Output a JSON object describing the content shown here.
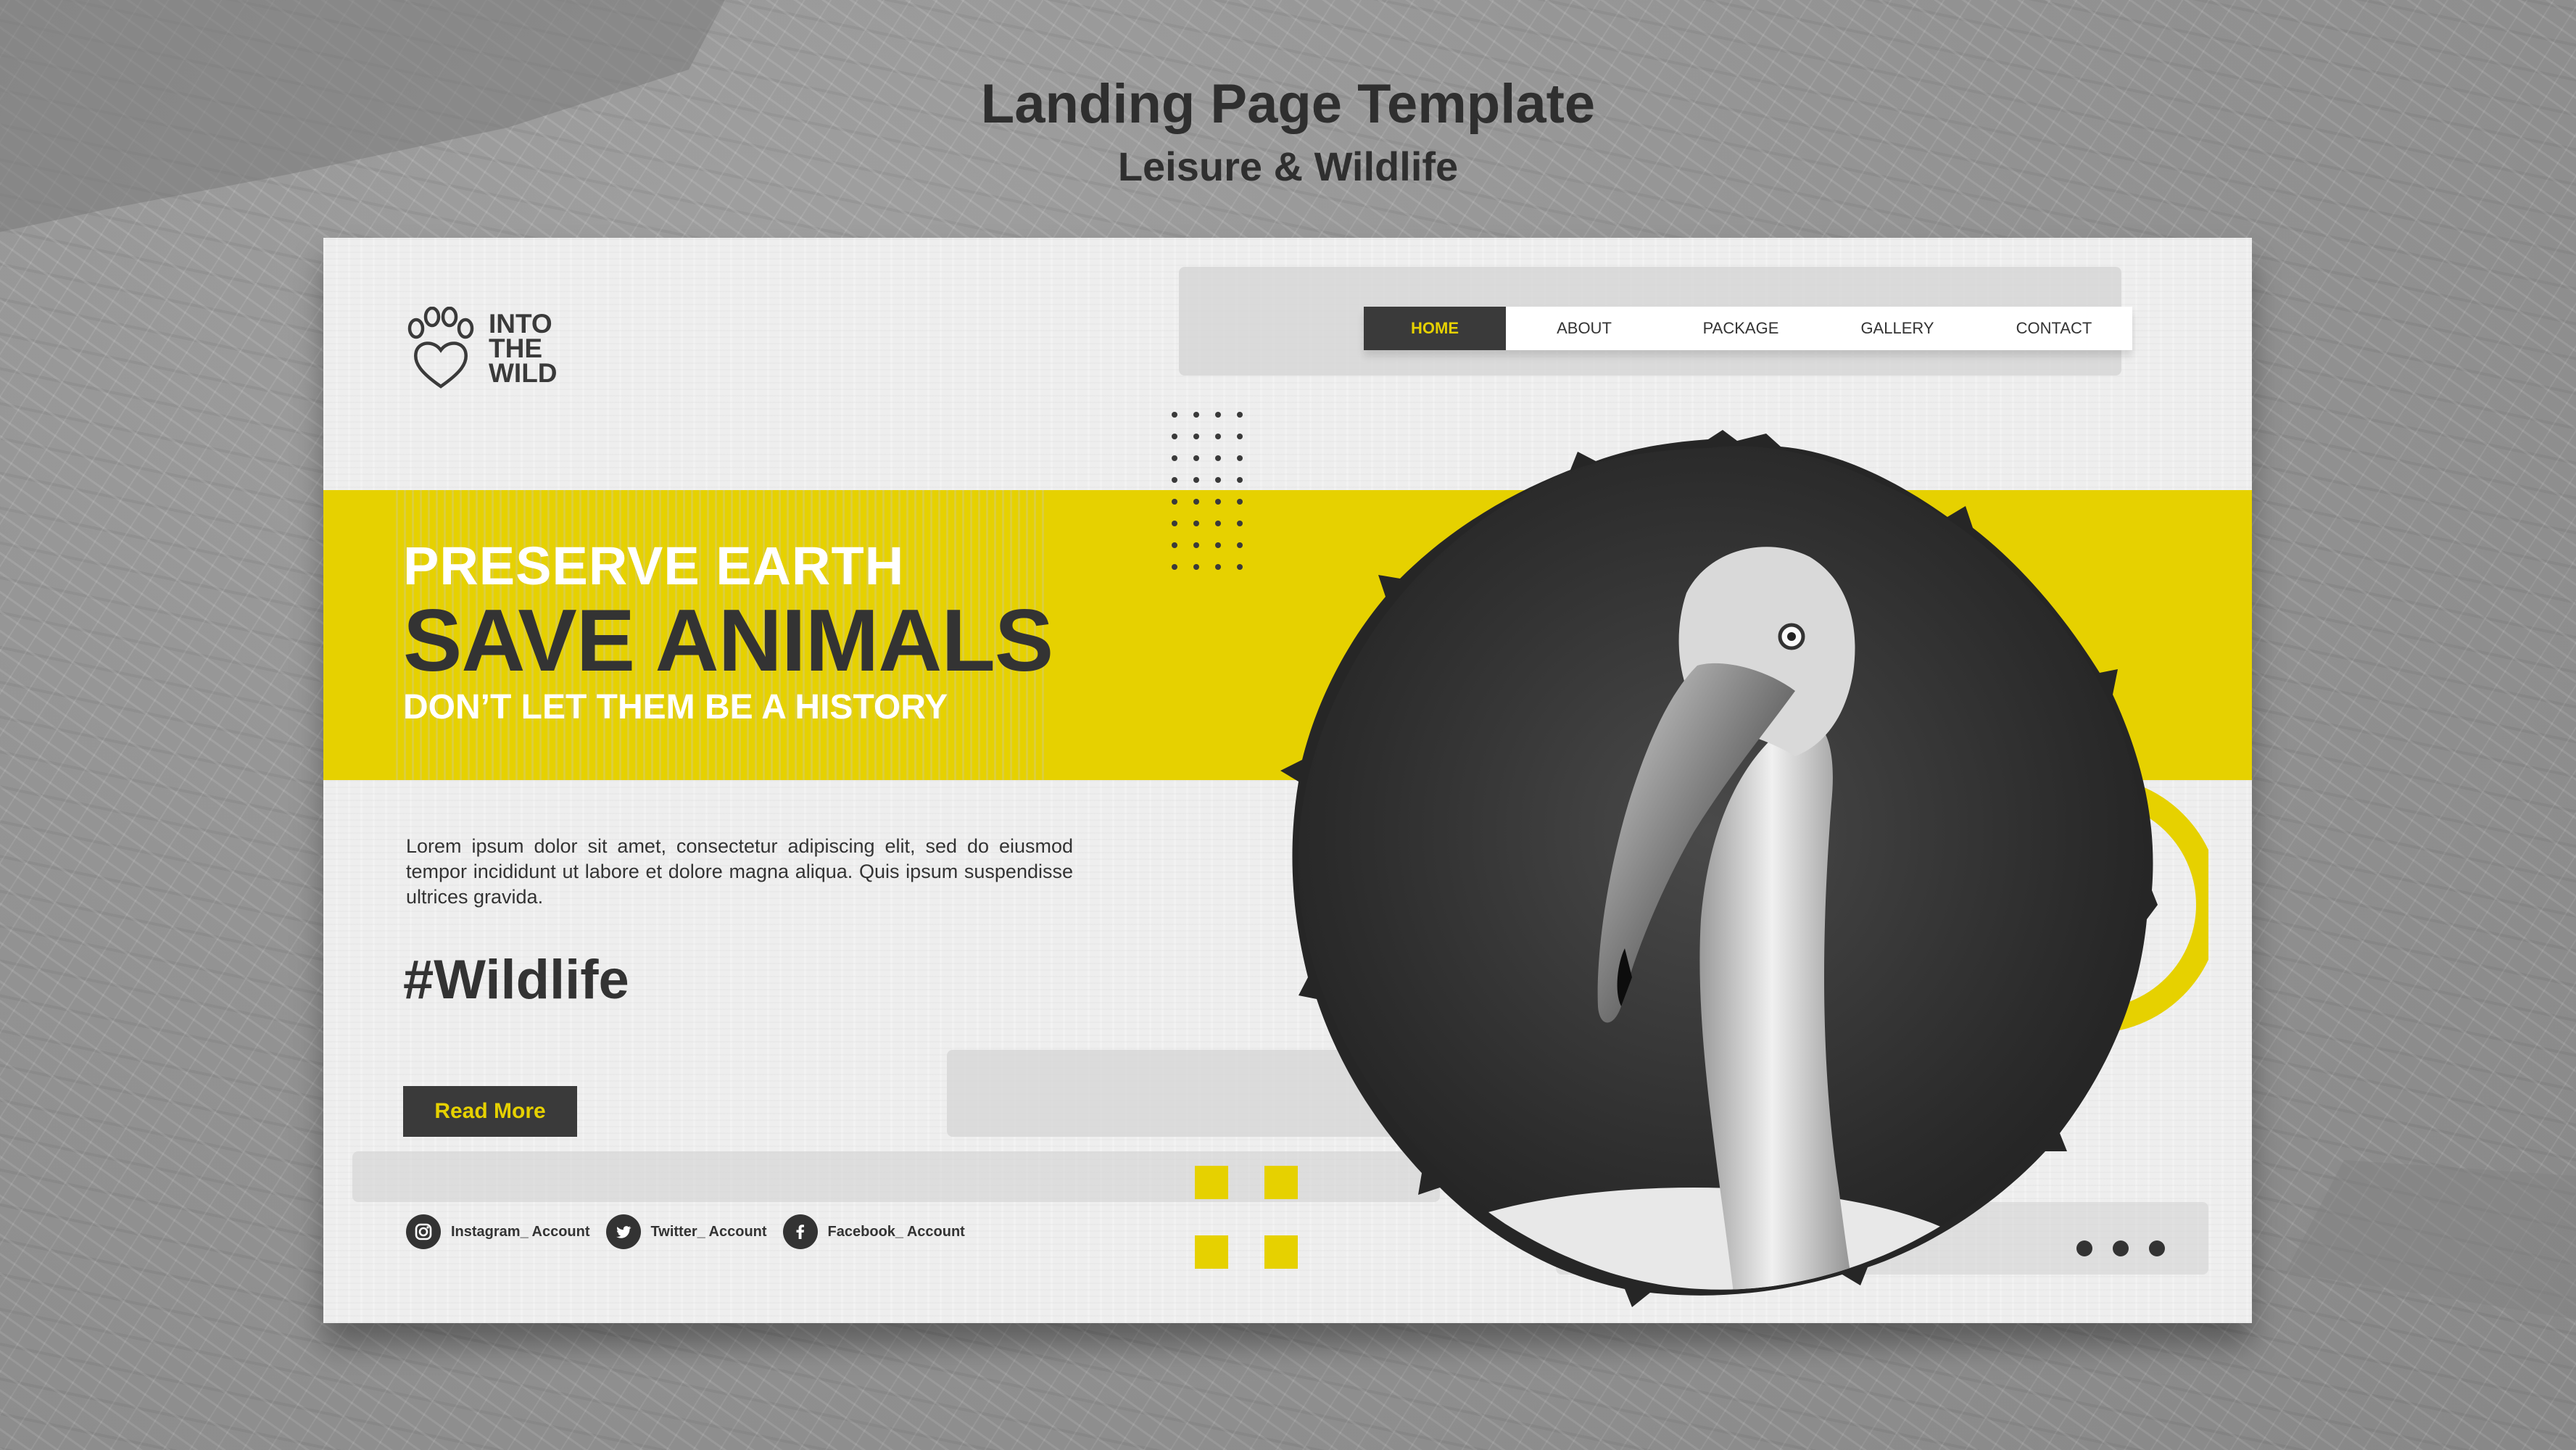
{
  "page": {
    "title": "Landing Page Template",
    "subtitle": "Leisure & Wildlife"
  },
  "colors": {
    "accent": "#e6d100",
    "dark": "#333333",
    "card": "#eeeeee"
  },
  "logo": {
    "icon": "paw-heart-icon",
    "line1": "INTO",
    "line2": "THE",
    "line3": "WILD"
  },
  "nav": {
    "items": [
      {
        "label": "HOME",
        "active": true
      },
      {
        "label": "ABOUT"
      },
      {
        "label": "PACKAGE"
      },
      {
        "label": "GALLERY"
      },
      {
        "label": "CONTACT"
      }
    ]
  },
  "hero": {
    "line1": "PRESERVE EARTH",
    "line2": "SAVE ANIMALS",
    "line3": "DON’T LET THEM BE A HISTORY",
    "body": "Lorem ipsum dolor sit amet, consectetur adipiscing elit, sed do eiusmod tempor incididunt ut labore et dolore magna aliqua. Quis ipsum suspendisse ultrices gravida.",
    "hashtag": "#Wildlife",
    "cta": "Read More"
  },
  "socials": [
    {
      "icon": "instagram-icon",
      "label": "Instagram_ Account"
    },
    {
      "icon": "twitter-icon",
      "label": "Twitter_ Account"
    },
    {
      "icon": "facebook-icon",
      "label": "Facebook_ Account"
    }
  ],
  "image": {
    "subject": "flamingo-photo"
  }
}
